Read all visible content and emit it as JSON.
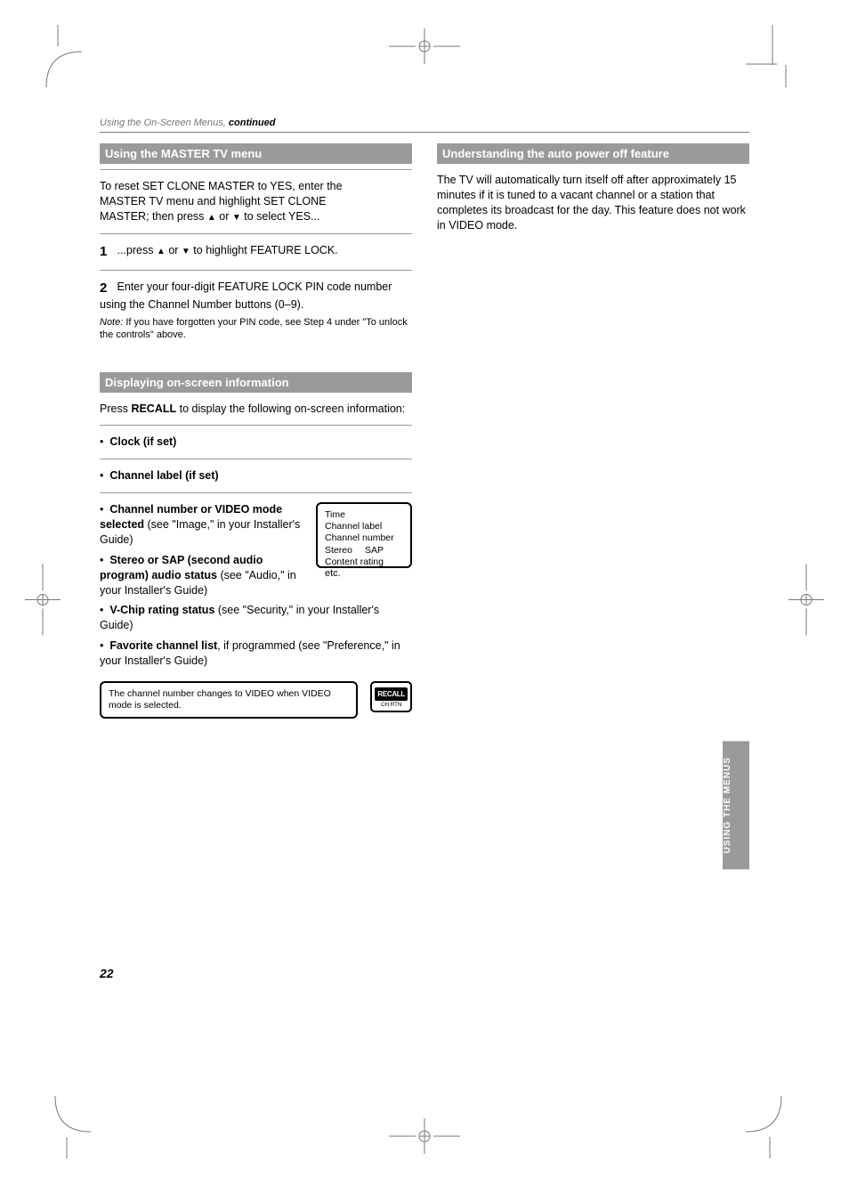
{
  "breadcrumb": {
    "prefix": "Using the On-Screen Menus, ",
    "strong": "continued"
  },
  "left": {
    "section1_title": "Using the MASTER TV menu",
    "step0a": "To reset SET CLONE MASTER to YES, enter the",
    "step0b": "MASTER TV menu and highlight SET CLONE",
    "step0c_pre": "MASTER; then press ",
    "step0c_post": " to select YES...",
    "step1_num": "1",
    "step1_pre": "...press ",
    "step1_mid": " or ",
    "step1_post": " to highlight FEATURE LOCK.",
    "step2_num": "2",
    "step2a": "Enter your four-digit FEATURE LOCK PIN code number",
    "step2b": "using the Channel Number buttons (0–9).",
    "step2_note_label": "Note: ",
    "step2_note": "If you have forgotten your PIN code, see Step 4 under \"To unlock the controls\" above.",
    "section2_title": "Displaying on-screen information",
    "lead_pre": "Press ",
    "lead_btn": "RECALL",
    "lead_post": " to display the following on-screen information:",
    "b1": "Clock (if set)",
    "b2": "Channel label (if set)",
    "b3_pre": "Channel number or VIDEO mode selected",
    "b3_post": " (see \"Image,\" in your Installer's Guide)",
    "b4_pre": "Stereo or SAP (second audio program) audio status",
    "b4_post": " (see \"Audio,\" in your Installer's Guide)",
    "b5_pre": "V-Chip rating status",
    "b5_post": " (see \"Security,\" in your Installer's Guide)",
    "b6_pre": "Favorite channel list",
    "b6_post": ", if programmed (see \"Preference,\" in your Installer's Guide)",
    "panel_line1": "Time",
    "panel_line2": "Channel label",
    "panel_line3": "Channel number",
    "panel_line4": "Stereo",
    "panel_line5": "SAP",
    "panel_line6": "Content rating",
    "panel_line7": "etc.",
    "callout": "The channel number changes to VIDEO when VIDEO mode is selected."
  },
  "right": {
    "section_title": "Understanding the auto power off feature",
    "p1": "The TV will automatically turn itself off after approximately 15 minutes if it is tuned to a vacant channel or a station that completes its broadcast for the day. This feature does not work in VIDEO mode."
  },
  "recall_btn": {
    "label": "RECALL",
    "sub": "CH RTN"
  },
  "page_num": "22",
  "side_tab": "Using the Menus"
}
